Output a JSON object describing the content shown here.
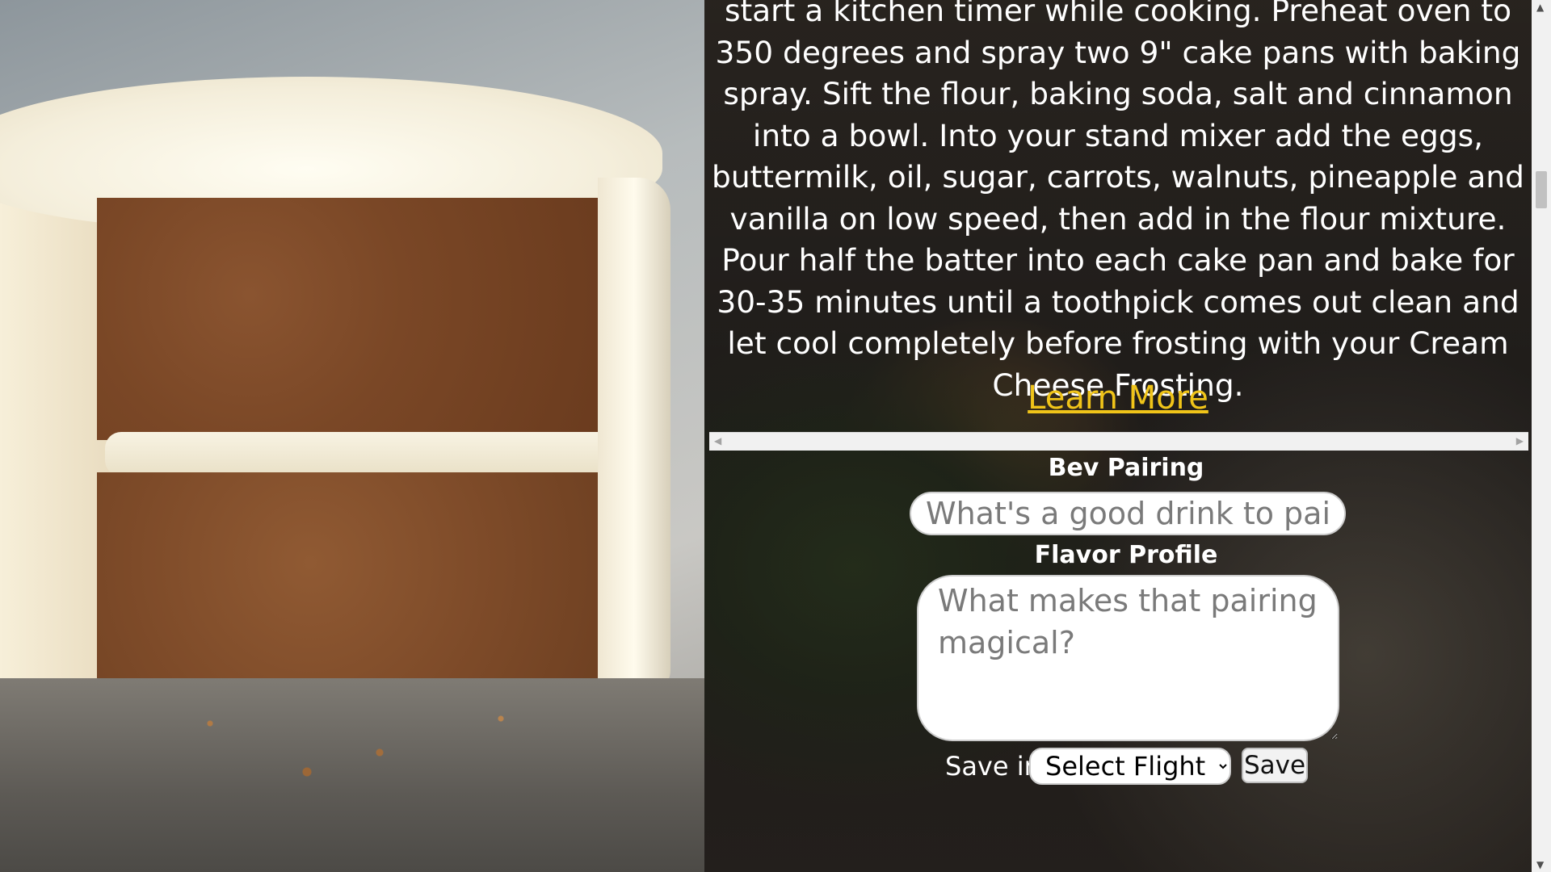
{
  "recipe": {
    "instructions": "start a kitchen timer while cooking. Preheat oven to 350 degrees and spray two 9\" cake pans with baking spray. Sift the flour, baking soda, salt and cinnamon into a bowl. Into your stand mixer add the eggs, buttermilk, oil, sugar, carrots, walnuts, pineapple and vanilla on low speed, then add in the flour mixture. Pour half the batter into each cake pan and bake for 30-35 minutes until a toothpick comes out clean and let cool completely before frosting with your Cream Cheese Frosting.",
    "learn_more": "Learn More"
  },
  "pairing_form": {
    "bev_label": "Bev Pairing",
    "bev_placeholder": "What's a good drink to pair?",
    "flavor_label": "Flavor Profile",
    "flavor_placeholder": "What makes that pairing magical?",
    "save_in_label": "Save in",
    "flight_select_value": "Select Flight",
    "save_button": "Save"
  },
  "colors": {
    "link": "#f0c419",
    "text": "#ffffff"
  }
}
